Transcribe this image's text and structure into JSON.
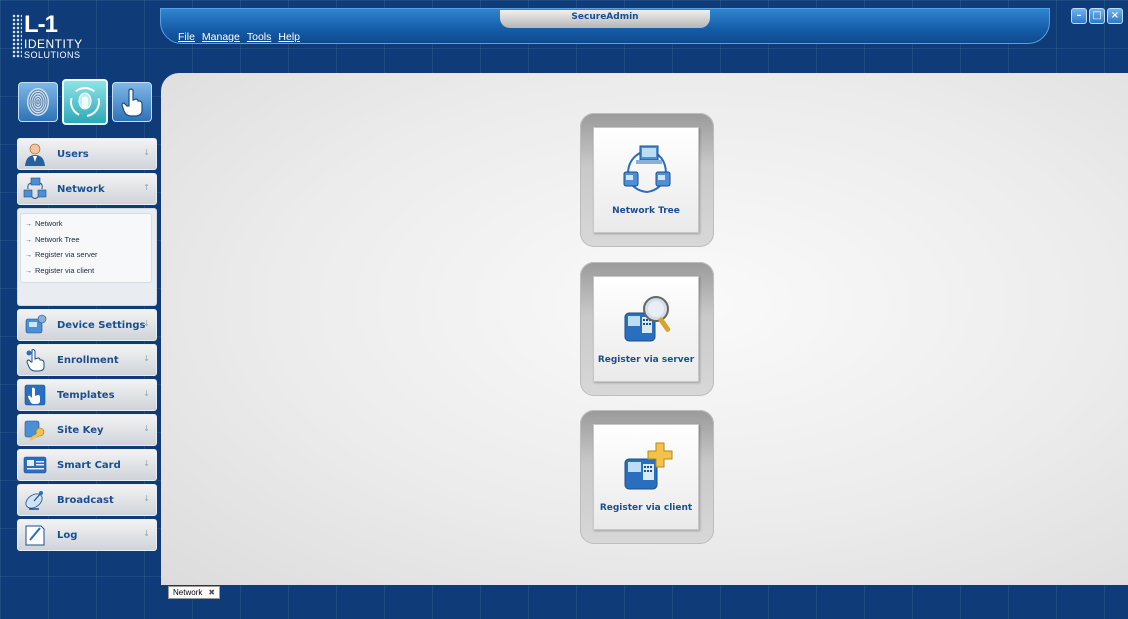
{
  "logo": {
    "line1": "L-1",
    "line2": "IDENTITY",
    "line3": "SOLUTIONS"
  },
  "window": {
    "title": "SecureAdmin",
    "minimize_glyph": "–",
    "maximize_glyph": "□",
    "close_glyph": "×"
  },
  "menu": {
    "file": "File",
    "manage": "Manage",
    "tools": "Tools",
    "help": "Help"
  },
  "sidebar": {
    "items": [
      {
        "label": "Users",
        "icon": "user-icon",
        "expanded": false
      },
      {
        "label": "Network",
        "icon": "network-icon",
        "expanded": true,
        "sub": [
          "Network",
          "Network Tree",
          "Register via server",
          "Register via client"
        ]
      },
      {
        "label": "Device Settings",
        "icon": "device-settings-icon",
        "expanded": false
      },
      {
        "label": "Enrollment",
        "icon": "enrollment-hand-icon",
        "expanded": false
      },
      {
        "label": "Templates",
        "icon": "templates-icon",
        "expanded": false
      },
      {
        "label": "Site Key",
        "icon": "site-key-icon",
        "expanded": false
      },
      {
        "label": "Smart Card",
        "icon": "smart-card-icon",
        "expanded": false
      },
      {
        "label": "Broadcast",
        "icon": "broadcast-icon",
        "expanded": false
      },
      {
        "label": "Log",
        "icon": "log-icon",
        "expanded": false
      }
    ]
  },
  "tiles": [
    {
      "label": "Network Tree",
      "icon": "network-tree-icon"
    },
    {
      "label": "Register via server",
      "icon": "register-server-icon"
    },
    {
      "label": "Register via client",
      "icon": "register-client-icon"
    }
  ],
  "doc_tab": {
    "label": "Network",
    "close_glyph": "✖"
  }
}
